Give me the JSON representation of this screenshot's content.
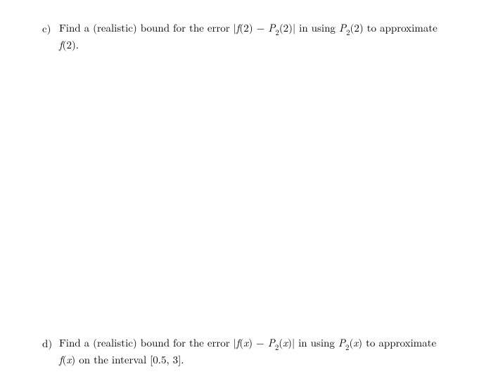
{
  "items": {
    "c": {
      "label": "c)",
      "text1": "Find a (realistic) bound for the error |",
      "f": "f",
      "val1": "(2) − ",
      "P": "P",
      "sub2": "2",
      "val2": "(2)| in using ",
      "val3": "(2) to approximate ",
      "f2": "f",
      "val4": "(2)."
    },
    "d": {
      "label": "d)",
      "text1": "Find a (realistic) bound for the error |",
      "f": "f",
      "x1": "x",
      "mid": ") − ",
      "P": "P",
      "sub2": "2",
      "x2": "x",
      "after": ")| in using ",
      "x3": "x",
      "approx": ") to approximate",
      "f2": "f",
      "x4": "x",
      "interval": ") on the interval [0.5, 3]."
    }
  }
}
